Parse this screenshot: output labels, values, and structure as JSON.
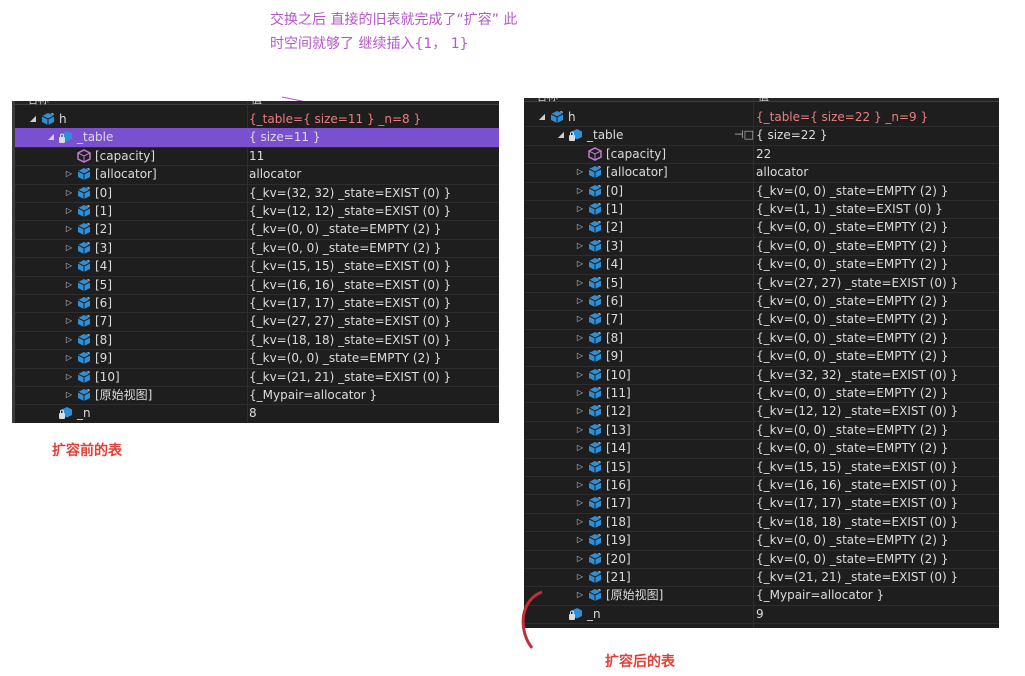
{
  "annotations": {
    "top_line1": "交换之后 直接的旧表就完成了“扩容” 此",
    "top_line2": "时空间就够了 继续插入{1， 1}",
    "before": "扩容前的表",
    "after": "扩容后的表"
  },
  "colors": {
    "panel_bg": "#1e1e1e",
    "selection": "#7a4fd0",
    "text": "#dcdcdc",
    "annotation_purple": "#b557c9",
    "annotation_red": "#e0413a",
    "icon_blue": "#2f8fd6",
    "icon_purple": "#c27bd1"
  },
  "left_panel": {
    "header": {
      "name": "名称",
      "value": "值"
    },
    "rows": [
      {
        "name": "h",
        "value": "{_table={ size=11 } _n=8 }",
        "expander": "◢",
        "icon": "object-icon"
      },
      {
        "name": "_table",
        "value": "{ size=11 }",
        "expander": "◢",
        "icon": "locked-object-icon"
      },
      {
        "name": "[capacity]",
        "value": "11",
        "expander": "",
        "icon": "cube-icon"
      },
      {
        "name": "[allocator]",
        "value": "allocator",
        "expander": "▷",
        "icon": "object-icon"
      },
      {
        "name": "[0]",
        "value": "{_kv=(32, 32) _state=EXIST (0) }",
        "expander": "▷",
        "icon": "object-icon"
      },
      {
        "name": "[1]",
        "value": "{_kv=(12, 12) _state=EXIST (0) }",
        "expander": "▷",
        "icon": "object-icon"
      },
      {
        "name": "[2]",
        "value": "{_kv=(0, 0) _state=EMPTY (2) }",
        "expander": "▷",
        "icon": "object-icon"
      },
      {
        "name": "[3]",
        "value": "{_kv=(0, 0) _state=EMPTY (2) }",
        "expander": "▷",
        "icon": "object-icon"
      },
      {
        "name": "[4]",
        "value": "{_kv=(15, 15) _state=EXIST (0) }",
        "expander": "▷",
        "icon": "object-icon"
      },
      {
        "name": "[5]",
        "value": "{_kv=(16, 16) _state=EXIST (0) }",
        "expander": "▷",
        "icon": "object-icon"
      },
      {
        "name": "[6]",
        "value": "{_kv=(17, 17) _state=EXIST (0) }",
        "expander": "▷",
        "icon": "object-icon"
      },
      {
        "name": "[7]",
        "value": "{_kv=(27, 27) _state=EXIST (0) }",
        "expander": "▷",
        "icon": "object-icon"
      },
      {
        "name": "[8]",
        "value": "{_kv=(18, 18) _state=EXIST (0) }",
        "expander": "▷",
        "icon": "object-icon"
      },
      {
        "name": "[9]",
        "value": "{_kv=(0, 0) _state=EMPTY (2) }",
        "expander": "▷",
        "icon": "object-icon"
      },
      {
        "name": "[10]",
        "value": "{_kv=(21, 21) _state=EXIST (0) }",
        "expander": "▷",
        "icon": "object-icon"
      },
      {
        "name": "[原始视图]",
        "value": "{_Mypair=allocator }",
        "expander": "▷",
        "icon": "object-icon"
      },
      {
        "name": "_n",
        "value": "8",
        "expander": "",
        "icon": "locked-object-icon"
      }
    ]
  },
  "right_panel": {
    "header": {
      "name": "名称",
      "value": "值"
    },
    "pin_glyph": "⊣□",
    "rows": [
      {
        "name": "h",
        "value": "{_table={ size=22 } _n=9 }",
        "expander": "◢",
        "icon": "object-icon"
      },
      {
        "name": "_table",
        "value": "{ size=22 }",
        "expander": "◢",
        "icon": "locked-object-icon"
      },
      {
        "name": "[capacity]",
        "value": "22",
        "expander": "",
        "icon": "cube-icon"
      },
      {
        "name": "[allocator]",
        "value": "allocator",
        "expander": "▷",
        "icon": "object-icon"
      },
      {
        "name": "[0]",
        "value": "{_kv=(0, 0) _state=EMPTY (2) }",
        "expander": "▷",
        "icon": "object-icon"
      },
      {
        "name": "[1]",
        "value": "{_kv=(1, 1) _state=EXIST (0) }",
        "expander": "▷",
        "icon": "object-icon"
      },
      {
        "name": "[2]",
        "value": "{_kv=(0, 0) _state=EMPTY (2) }",
        "expander": "▷",
        "icon": "object-icon"
      },
      {
        "name": "[3]",
        "value": "{_kv=(0, 0) _state=EMPTY (2) }",
        "expander": "▷",
        "icon": "object-icon"
      },
      {
        "name": "[4]",
        "value": "{_kv=(0, 0) _state=EMPTY (2) }",
        "expander": "▷",
        "icon": "object-icon"
      },
      {
        "name": "[5]",
        "value": "{_kv=(27, 27) _state=EXIST (0) }",
        "expander": "▷",
        "icon": "object-icon"
      },
      {
        "name": "[6]",
        "value": "{_kv=(0, 0) _state=EMPTY (2) }",
        "expander": "▷",
        "icon": "object-icon"
      },
      {
        "name": "[7]",
        "value": "{_kv=(0, 0) _state=EMPTY (2) }",
        "expander": "▷",
        "icon": "object-icon"
      },
      {
        "name": "[8]",
        "value": "{_kv=(0, 0) _state=EMPTY (2) }",
        "expander": "▷",
        "icon": "object-icon"
      },
      {
        "name": "[9]",
        "value": "{_kv=(0, 0) _state=EMPTY (2) }",
        "expander": "▷",
        "icon": "object-icon"
      },
      {
        "name": "[10]",
        "value": "{_kv=(32, 32) _state=EXIST (0) }",
        "expander": "▷",
        "icon": "object-icon"
      },
      {
        "name": "[11]",
        "value": "{_kv=(0, 0) _state=EMPTY (2) }",
        "expander": "▷",
        "icon": "object-icon"
      },
      {
        "name": "[12]",
        "value": "{_kv=(12, 12) _state=EXIST (0) }",
        "expander": "▷",
        "icon": "object-icon"
      },
      {
        "name": "[13]",
        "value": "{_kv=(0, 0) _state=EMPTY (2) }",
        "expander": "▷",
        "icon": "object-icon"
      },
      {
        "name": "[14]",
        "value": "{_kv=(0, 0) _state=EMPTY (2) }",
        "expander": "▷",
        "icon": "object-icon"
      },
      {
        "name": "[15]",
        "value": "{_kv=(15, 15) _state=EXIST (0) }",
        "expander": "▷",
        "icon": "object-icon"
      },
      {
        "name": "[16]",
        "value": "{_kv=(16, 16) _state=EXIST (0) }",
        "expander": "▷",
        "icon": "object-icon"
      },
      {
        "name": "[17]",
        "value": "{_kv=(17, 17) _state=EXIST (0) }",
        "expander": "▷",
        "icon": "object-icon"
      },
      {
        "name": "[18]",
        "value": "{_kv=(18, 18) _state=EXIST (0) }",
        "expander": "▷",
        "icon": "object-icon"
      },
      {
        "name": "[19]",
        "value": "{_kv=(0, 0) _state=EMPTY (2) }",
        "expander": "▷",
        "icon": "object-icon"
      },
      {
        "name": "[20]",
        "value": "{_kv=(0, 0) _state=EMPTY (2) }",
        "expander": "▷",
        "icon": "object-icon"
      },
      {
        "name": "[21]",
        "value": "{_kv=(21, 21) _state=EXIST (0) }",
        "expander": "▷",
        "icon": "object-icon"
      },
      {
        "name": "[原始视图]",
        "value": "{_Mypair=allocator }",
        "expander": "▷",
        "icon": "object-icon"
      },
      {
        "name": "_n",
        "value": "9",
        "expander": "",
        "icon": "locked-object-icon"
      }
    ]
  }
}
